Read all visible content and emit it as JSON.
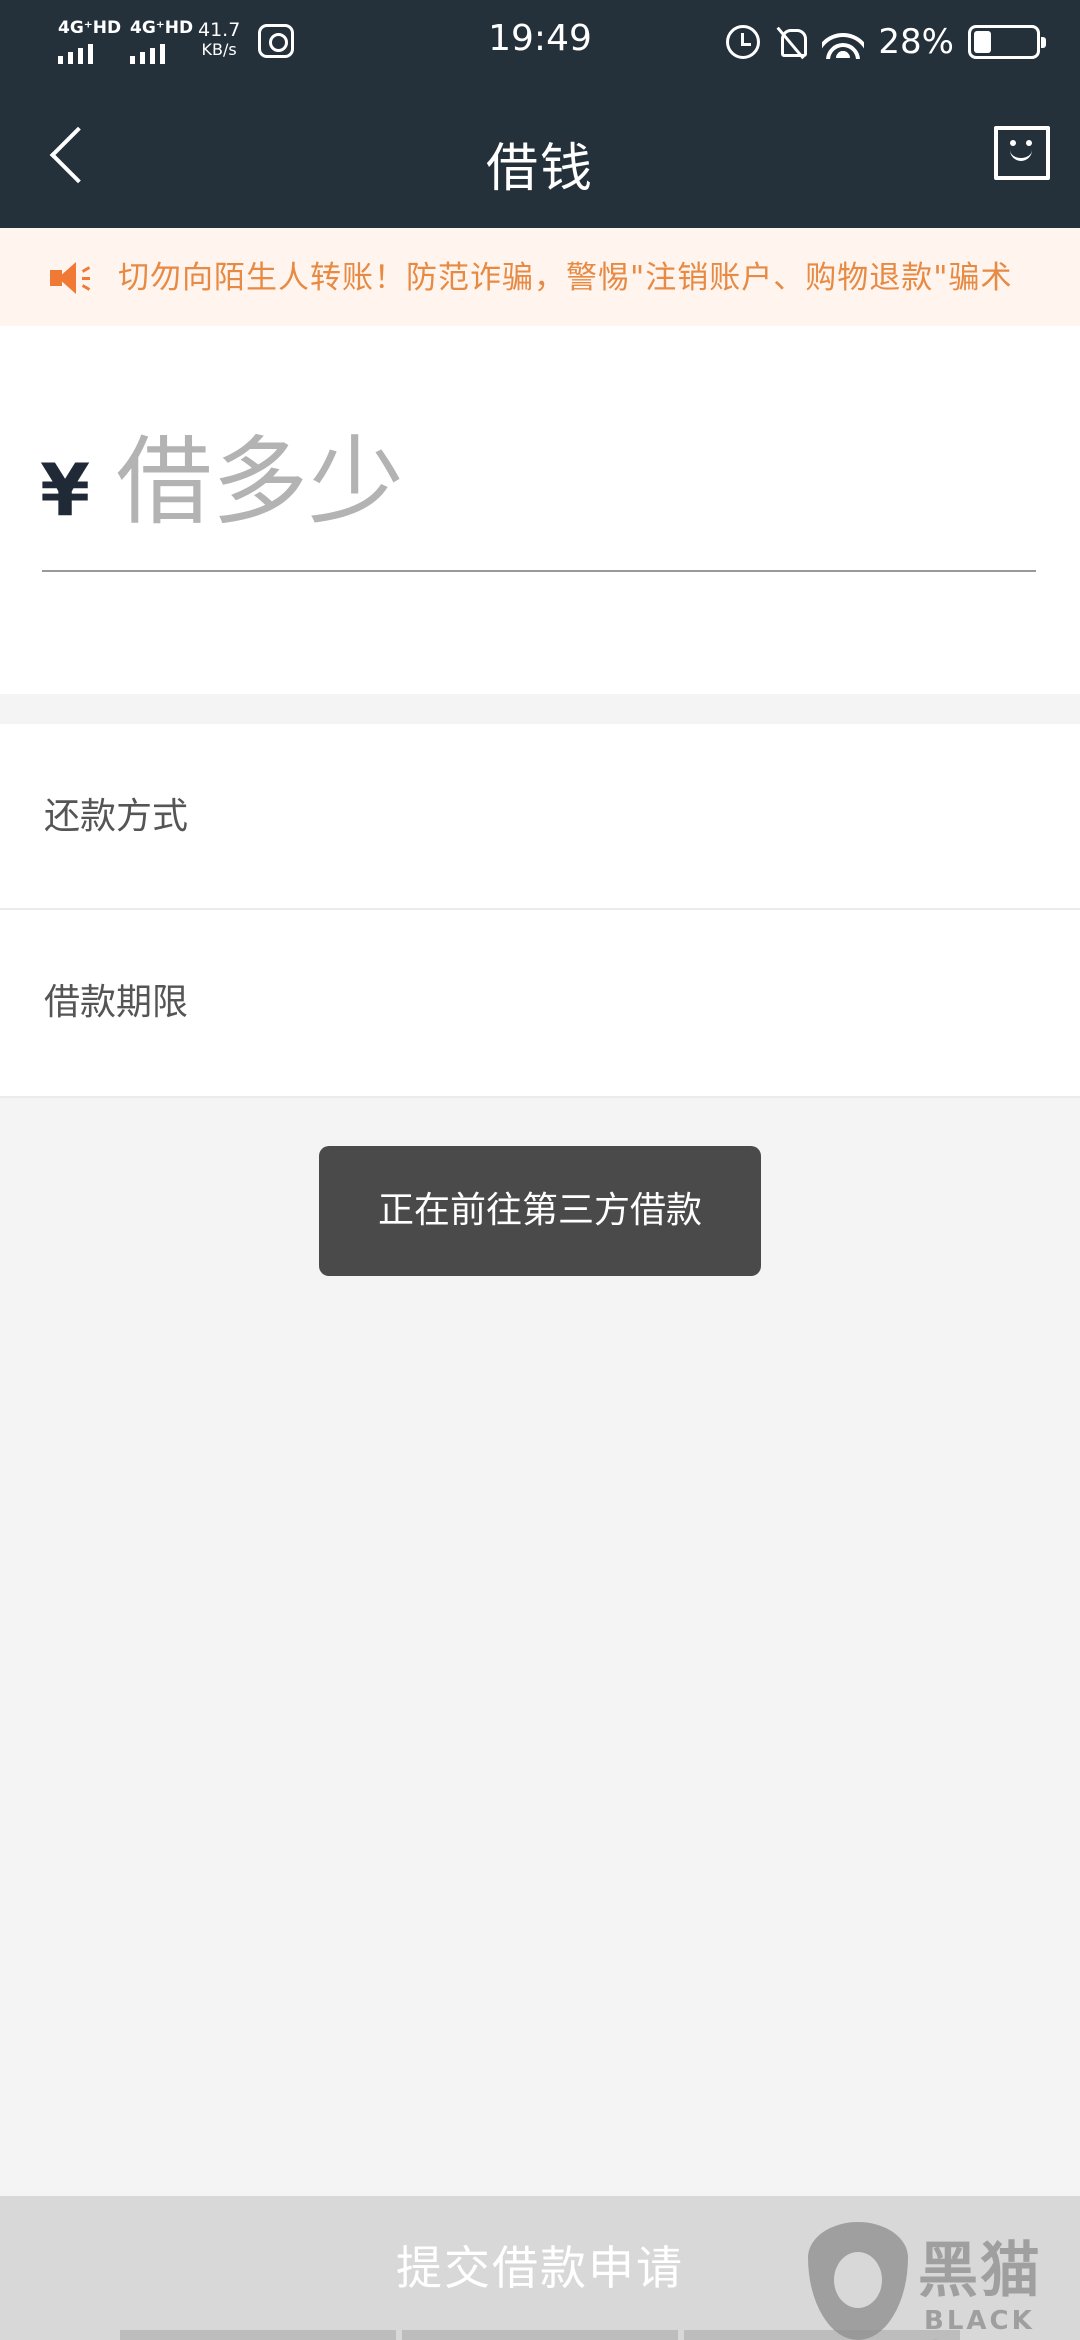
{
  "status_bar": {
    "sim1_network": "4G⁺HD",
    "sim2_network": "4G⁺HD",
    "speed_value": "41.7",
    "speed_unit": "KB/s",
    "time": "19:49",
    "battery_percent": "28%",
    "battery_level": 0.28
  },
  "header": {
    "title": "借钱"
  },
  "notice": {
    "text": "切勿向陌生人转账！防范诈骗，警惕\"注销账户、购物退款\"骗术"
  },
  "amount": {
    "currency_symbol": "¥",
    "placeholder": "借多少",
    "value": ""
  },
  "options": [
    {
      "label": "还款方式"
    },
    {
      "label": "借款期限"
    }
  ],
  "toast": {
    "text": "正在前往第三方借款"
  },
  "footer": {
    "submit_label": "提交借款申请"
  },
  "watermark": {
    "cn": "黑猫",
    "en": "BLACK CAT"
  },
  "colors": {
    "header_bg": "#24303a",
    "notice_bg": "#fff4ee",
    "notice_text": "#e78a43",
    "toast_bg": "#4a4a4a",
    "submit_disabled_bg": "#d8d8d8"
  }
}
